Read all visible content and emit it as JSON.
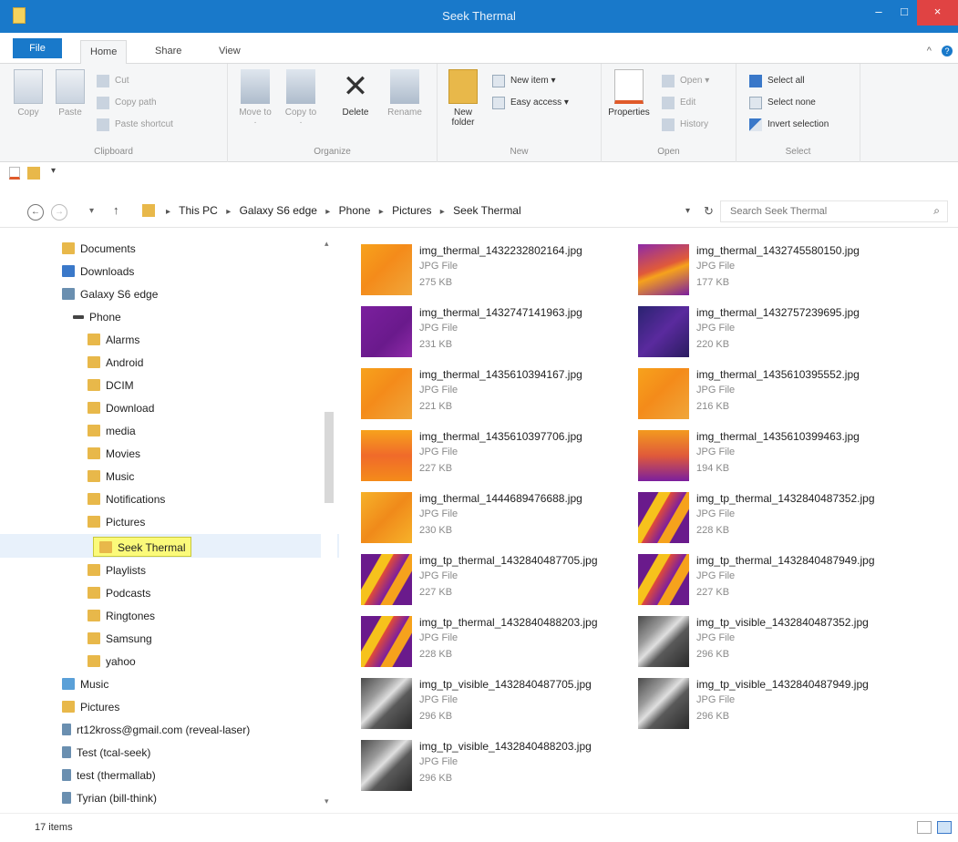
{
  "window": {
    "title": "Seek Thermal",
    "minimize": "–",
    "maximize": "□",
    "close": "×"
  },
  "tabs": {
    "file": "File",
    "home": "Home",
    "share": "Share",
    "view": "View",
    "collapse": "^",
    "help": "?"
  },
  "ribbon": {
    "clipboard": {
      "label": "Clipboard",
      "copy": "Copy",
      "paste": "Paste",
      "cut": "Cut",
      "copy_path": "Copy path",
      "paste_shortcut": "Paste shortcut"
    },
    "organize": {
      "label": "Organize",
      "move_to": "Move to ·",
      "copy_to": "Copy to ·",
      "delete": "Delete",
      "rename": "Rename"
    },
    "new": {
      "label": "New",
      "new_folder": "New folder",
      "new_item": "New item ▾",
      "easy_access": "Easy access ▾"
    },
    "open": {
      "label": "Open",
      "properties": "Properties",
      "open": "Open ▾",
      "edit": "Edit",
      "history": "History"
    },
    "select": {
      "label": "Select",
      "select_all": "Select all",
      "select_none": "Select none",
      "invert_selection": "Invert selection"
    }
  },
  "quickbar": {
    "dropdown": "▾"
  },
  "nav": {
    "back": "←",
    "forward": "→",
    "recent": "▾",
    "up": "↑",
    "breadcrumbs": [
      "This PC",
      "Galaxy S6 edge",
      "Phone",
      "Pictures",
      "Seek Thermal"
    ],
    "separator": "▸",
    "address_dropdown": "▾",
    "refresh": "↻",
    "search_placeholder": "Search Seek Thermal",
    "search_icon": "⌕"
  },
  "tree": {
    "items": [
      {
        "label": "Documents",
        "icon": "folder-icon"
      },
      {
        "label": "Downloads",
        "icon": "downloads-icon"
      },
      {
        "label": "Galaxy S6 edge",
        "icon": "device-icon"
      },
      {
        "label": "Phone",
        "icon": "phone-storage-icon"
      },
      {
        "label": "Alarms",
        "icon": "folder-icon"
      },
      {
        "label": "Android",
        "icon": "folder-icon"
      },
      {
        "label": "DCIM",
        "icon": "folder-icon"
      },
      {
        "label": "Download",
        "icon": "folder-icon"
      },
      {
        "label": "media",
        "icon": "folder-icon"
      },
      {
        "label": "Movies",
        "icon": "folder-icon"
      },
      {
        "label": "Music",
        "icon": "folder-icon"
      },
      {
        "label": "Notifications",
        "icon": "folder-icon"
      },
      {
        "label": "Pictures",
        "icon": "folder-icon"
      },
      {
        "label": "Seek Thermal",
        "icon": "folder-icon"
      },
      {
        "label": "Playlists",
        "icon": "folder-icon"
      },
      {
        "label": "Podcasts",
        "icon": "folder-icon"
      },
      {
        "label": "Ringtones",
        "icon": "folder-icon"
      },
      {
        "label": "Samsung",
        "icon": "folder-icon"
      },
      {
        "label": "yahoo",
        "icon": "folder-icon"
      },
      {
        "label": "Music",
        "icon": "music-icon"
      },
      {
        "label": "Pictures",
        "icon": "pictures-icon"
      },
      {
        "label": "rt12kross@gmail.com (reveal-laser)",
        "icon": "network-icon"
      },
      {
        "label": "Test (tcal-seek)",
        "icon": "network-icon"
      },
      {
        "label": "test (thermallab)",
        "icon": "network-icon"
      },
      {
        "label": "Tyrian (bill-think)",
        "icon": "network-icon"
      }
    ],
    "scroll_up": "▴",
    "scroll_down": "▾"
  },
  "files": [
    {
      "name": "img_thermal_1432232802164.jpg",
      "type": "JPG File",
      "size": "275 KB"
    },
    {
      "name": "img_thermal_1432745580150.jpg",
      "type": "JPG File",
      "size": "177 KB"
    },
    {
      "name": "img_thermal_1432747141963.jpg",
      "type": "JPG File",
      "size": "231 KB"
    },
    {
      "name": "img_thermal_1432757239695.jpg",
      "type": "JPG File",
      "size": "220 KB"
    },
    {
      "name": "img_thermal_1435610394167.jpg",
      "type": "JPG File",
      "size": "221 KB"
    },
    {
      "name": "img_thermal_1435610395552.jpg",
      "type": "JPG File",
      "size": "216 KB"
    },
    {
      "name": "img_thermal_1435610397706.jpg",
      "type": "JPG File",
      "size": "227 KB"
    },
    {
      "name": "img_thermal_1435610399463.jpg",
      "type": "JPG File",
      "size": "194 KB"
    },
    {
      "name": "img_thermal_1444689476688.jpg",
      "type": "JPG File",
      "size": "230 KB"
    },
    {
      "name": "img_tp_thermal_1432840487352.jpg",
      "type": "JPG File",
      "size": "228 KB"
    },
    {
      "name": "img_tp_thermal_1432840487705.jpg",
      "type": "JPG File",
      "size": "227 KB"
    },
    {
      "name": "img_tp_thermal_1432840487949.jpg",
      "type": "JPG File",
      "size": "227 KB"
    },
    {
      "name": "img_tp_thermal_1432840488203.jpg",
      "type": "JPG File",
      "size": "228 KB"
    },
    {
      "name": "img_tp_visible_1432840487352.jpg",
      "type": "JPG File",
      "size": "296 KB"
    },
    {
      "name": "img_tp_visible_1432840487705.jpg",
      "type": "JPG File",
      "size": "296 KB"
    },
    {
      "name": "img_tp_visible_1432840487949.jpg",
      "type": "JPG File",
      "size": "296 KB"
    },
    {
      "name": "img_tp_visible_1432840488203.jpg",
      "type": "JPG File",
      "size": "296 KB"
    }
  ],
  "status": {
    "item_count": "17 items"
  },
  "colors": {
    "titlebar": "#1979ca",
    "close": "#e04343",
    "selection": "#fbfa7a",
    "folder": "#e8b84a"
  }
}
